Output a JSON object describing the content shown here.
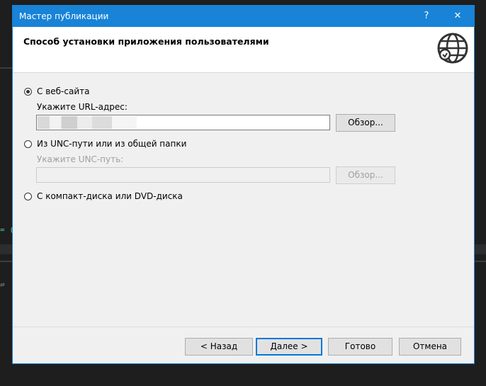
{
  "window": {
    "title": "Мастер публикации",
    "help_glyph": "?",
    "close_glyph": "✕"
  },
  "header": {
    "heading": "Способ установки приложения пользователями",
    "icon": "globe-icon"
  },
  "options": {
    "web": {
      "label": "С веб-сайта",
      "selected": true
    },
    "url_label": "Укажите URL-адрес:",
    "url_browse": "Обзор...",
    "unc": {
      "label": "Из UNC-пути или из общей папки",
      "selected": false
    },
    "unc_label": "Укажите UNC-путь:",
    "unc_browse": "Обзор...",
    "cd": {
      "label": "С компакт-диска или DVD-диска",
      "selected": false
    }
  },
  "footer": {
    "back": "< Назад",
    "next": "Далее >",
    "finish": "Готово",
    "cancel": "Отмена"
  },
  "colors": {
    "titlebar": "#1883d7",
    "ide_background": "#1e1e1e"
  }
}
